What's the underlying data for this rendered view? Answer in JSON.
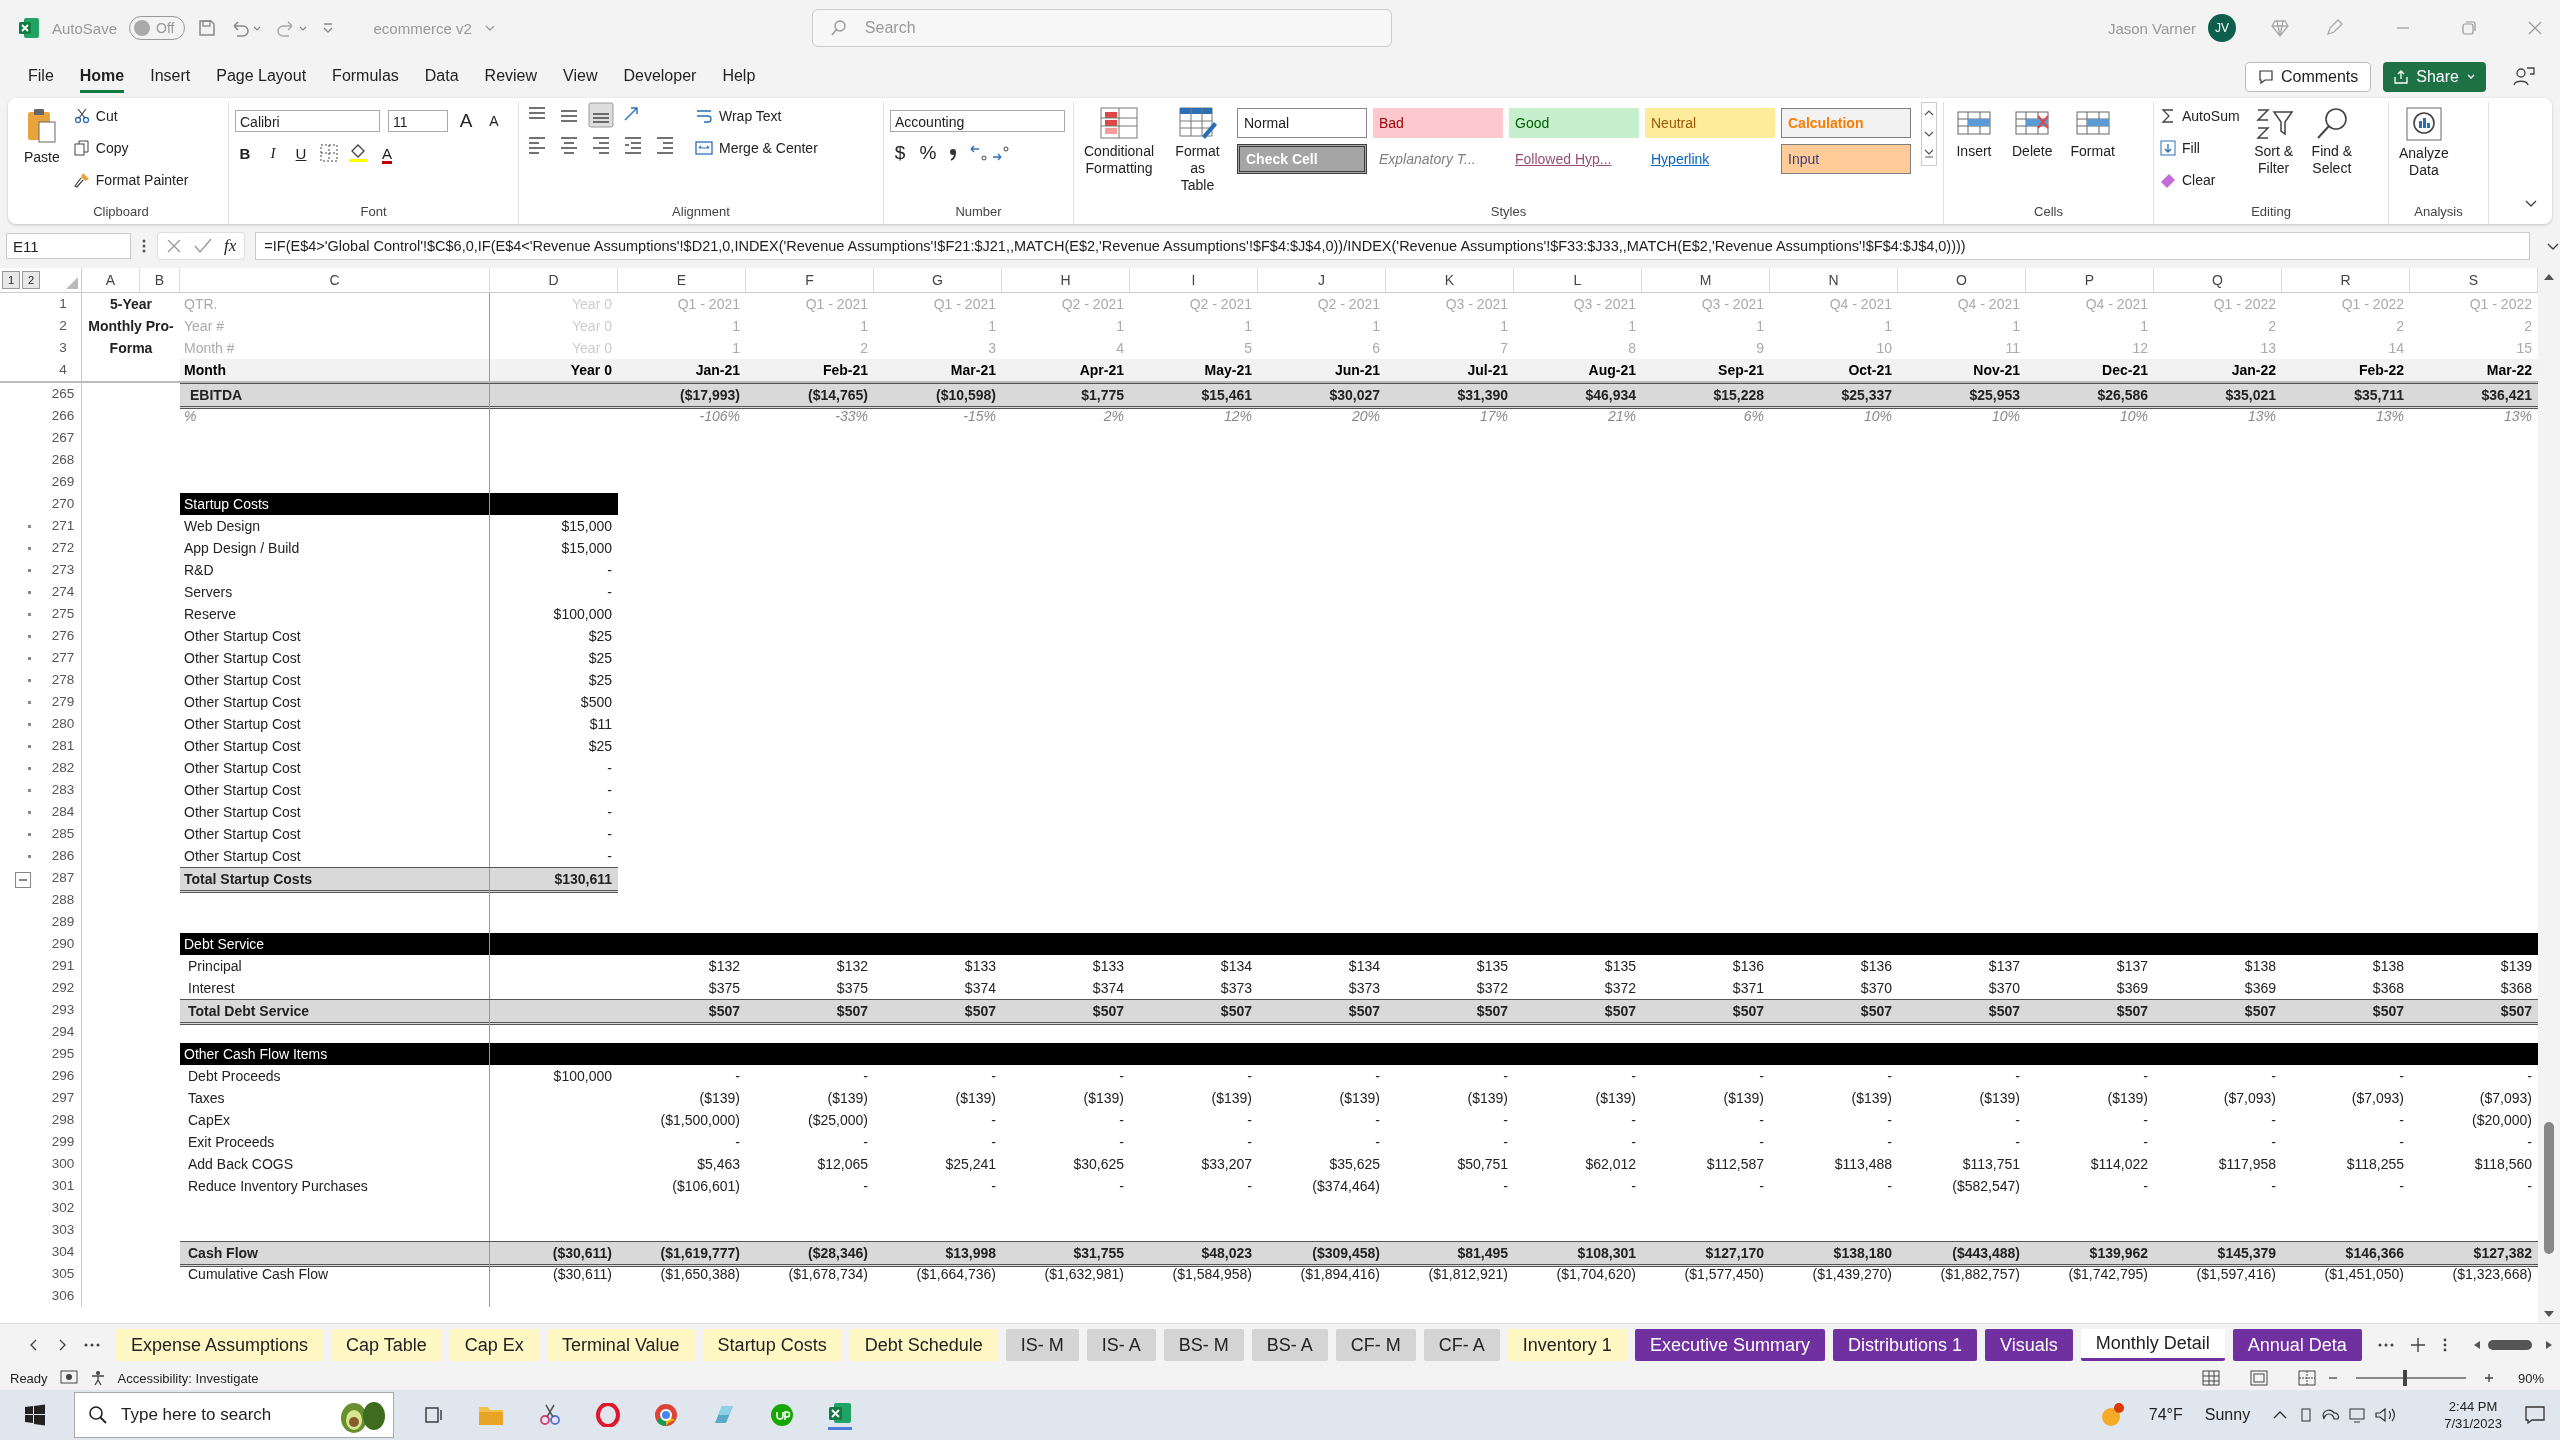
{
  "title_bar": {
    "autosave_label": "AutoSave",
    "autosave": {
      "on": false,
      "label": "Off"
    },
    "file_name": "ecommerce v2",
    "search_placeholder": "Search",
    "user_name": "Jason Varner",
    "avatar_initials": "JV"
  },
  "menu": [
    {
      "label": "File",
      "selected": false
    },
    {
      "label": "Home",
      "selected": true
    },
    {
      "label": "Insert",
      "selected": false
    },
    {
      "label": "Page Layout",
      "selected": false
    },
    {
      "label": "Formulas",
      "selected": false
    },
    {
      "label": "Data",
      "selected": false
    },
    {
      "label": "Review",
      "selected": false
    },
    {
      "label": "View",
      "selected": false
    },
    {
      "label": "Developer",
      "selected": false
    },
    {
      "label": "Help",
      "selected": false
    }
  ],
  "comments_button": "Comments",
  "share_button": "Share",
  "ribbon": {
    "clipboard": {
      "title": "Clipboard",
      "paste": "Paste",
      "cut": "Cut",
      "copy": "Copy",
      "format_painter": "Format Painter"
    },
    "font": {
      "title": "Font",
      "family": "Calibri",
      "size": "11",
      "grow": "A",
      "shrink": "A",
      "bold": "B",
      "italic": "I",
      "underline": "U",
      "font_color_button": "A"
    },
    "alignment": {
      "title": "Alignment",
      "wrap_text": "Wrap Text",
      "merge_center": "Merge & Center"
    },
    "number": {
      "title": "Number",
      "format": "Accounting",
      "currency": "$",
      "percent": "%"
    },
    "styles": {
      "title": "Styles",
      "conditional_formatting": [
        "Conditional",
        "Formatting"
      ],
      "format_as_table": [
        "Format as",
        "Table"
      ],
      "cell_styles": [
        {
          "label": "Normal",
          "kind": "normal"
        },
        {
          "label": "Bad",
          "kind": "bad"
        },
        {
          "label": "Good",
          "kind": "good"
        },
        {
          "label": "Neutral",
          "kind": "neutral"
        },
        {
          "label": "Calculation",
          "kind": "calculation"
        },
        {
          "label": "Check Cell",
          "kind": "check"
        },
        {
          "label": "Explanatory T...",
          "kind": "explanatory"
        },
        {
          "label": "Followed Hyp...",
          "kind": "followed"
        },
        {
          "label": "Hyperlink",
          "kind": "hyperlink"
        },
        {
          "label": "Input",
          "kind": "input"
        }
      ]
    },
    "cells": {
      "title": "Cells",
      "buttons": [
        "Insert",
        "Delete",
        "Format"
      ]
    },
    "editing": {
      "title": "Editing",
      "autosum": "AutoSum",
      "fill": "Fill",
      "clear": "Clear",
      "sort_filter": [
        "Sort &",
        "Filter"
      ],
      "find_select": [
        "Find &",
        "Select"
      ]
    },
    "analysis": {
      "title": "Analysis",
      "analyze_data": [
        "Analyze",
        "Data"
      ]
    }
  },
  "formula_bar": {
    "name_box": "E11",
    "fx": "fx",
    "formula": "=IF(E$4>'Global Control'!$C$6,0,IF(E$4<'Revenue Assumptions'!$D21,0,INDEX('Revenue Assumptions'!$F21:$J21,,MATCH(E$2,'Revenue Assumptions'!$F$4:$J$4,0))/INDEX('Revenue Assumptions'!$F33:$J33,,MATCH(E$2,'Revenue Assumptions'!$F$4:$J$4,0))))"
  },
  "grid": {
    "outline_levels": [
      "1",
      "2"
    ],
    "columns": [
      "A",
      "B",
      "C",
      "D",
      "E",
      "F",
      "G",
      "H",
      "I",
      "J",
      "K",
      "L",
      "M",
      "N",
      "O",
      "P",
      "Q",
      "R",
      "S"
    ],
    "header": {
      "title": "5-Year Monthly Pro-Forma",
      "row_numbers": [
        "1",
        "2",
        "3",
        "4"
      ],
      "labels": [
        "QTR.",
        "Year #",
        "Month #",
        "Month"
      ],
      "year0": [
        "Year 0",
        "Year 0",
        "Year 0",
        "Year 0"
      ],
      "quarters": [
        "Q1 - 2021",
        "Q1 - 2021",
        "Q1 - 2021",
        "Q2 - 2021",
        "Q2 - 2021",
        "Q2 - 2021",
        "Q3 - 2021",
        "Q3 - 2021",
        "Q3 - 2021",
        "Q4 - 2021",
        "Q4 - 2021",
        "Q4 - 2021",
        "Q1 - 2022",
        "Q1 - 2022",
        "Q1 - 2022"
      ],
      "years": [
        "1",
        "1",
        "1",
        "1",
        "1",
        "1",
        "1",
        "1",
        "1",
        "1",
        "1",
        "1",
        "2",
        "2",
        "2"
      ],
      "month_numbers": [
        "1",
        "2",
        "3",
        "4",
        "5",
        "6",
        "7",
        "8",
        "9",
        "10",
        "11",
        "12",
        "13",
        "14",
        "15"
      ],
      "months": [
        "Jan-21",
        "Feb-21",
        "Mar-21",
        "Apr-21",
        "May-21",
        "Jun-21",
        "Jul-21",
        "Aug-21",
        "Sep-21",
        "Oct-21",
        "Nov-21",
        "Dec-21",
        "Jan-22",
        "Feb-22",
        "Mar-22"
      ]
    },
    "rows": [
      {
        "row": "265",
        "kind": "ebitda",
        "label": "EBITDA",
        "values": [
          "($17,993)",
          "($14,765)",
          "($10,598)",
          "$1,775",
          "$15,461",
          "$30,027",
          "$31,390",
          "$46,934",
          "$15,228",
          "$25,337",
          "$25,953",
          "$26,586",
          "$35,021",
          "$35,711",
          "$36,421"
        ]
      },
      {
        "row": "266",
        "kind": "pct",
        "label": "%",
        "values": [
          "-106%",
          "-33%",
          "-15%",
          "2%",
          "12%",
          "20%",
          "17%",
          "21%",
          "6%",
          "10%",
          "10%",
          "10%",
          "13%",
          "13%",
          "13%"
        ]
      },
      {
        "row": "267",
        "kind": "blank"
      },
      {
        "row": "268",
        "kind": "blank"
      },
      {
        "row": "269",
        "kind": "blank"
      },
      {
        "row": "270",
        "kind": "section_narrow",
        "label": "Startup Costs"
      },
      {
        "row": "271",
        "kind": "item",
        "label": "Web Design",
        "d": "$15,000",
        "grouped": true
      },
      {
        "row": "272",
        "kind": "item",
        "label": "App Design / Build",
        "d": "$15,000",
        "grouped": true
      },
      {
        "row": "273",
        "kind": "item",
        "label": "R&D",
        "d": "-",
        "grouped": true
      },
      {
        "row": "274",
        "kind": "item",
        "label": "Servers",
        "d": "-",
        "grouped": true
      },
      {
        "row": "275",
        "kind": "item",
        "label": "Reserve",
        "d": "$100,000",
        "grouped": true
      },
      {
        "row": "276",
        "kind": "item",
        "label": "Other Startup Cost",
        "d": "$25",
        "grouped": true
      },
      {
        "row": "277",
        "kind": "item",
        "label": "Other Startup Cost",
        "d": "$25",
        "grouped": true
      },
      {
        "row": "278",
        "kind": "item",
        "label": "Other Startup Cost",
        "d": "$25",
        "grouped": true
      },
      {
        "row": "279",
        "kind": "item",
        "label": "Other Startup Cost",
        "d": "$500",
        "grouped": true
      },
      {
        "row": "280",
        "kind": "item",
        "label": "Other Startup Cost",
        "d": "$11",
        "grouped": true
      },
      {
        "row": "281",
        "kind": "item",
        "label": "Other Startup Cost",
        "d": "$25",
        "grouped": true
      },
      {
        "row": "282",
        "kind": "item",
        "label": "Other Startup Cost",
        "d": "-",
        "grouped": true
      },
      {
        "row": "283",
        "kind": "item",
        "label": "Other Startup Cost",
        "d": "-",
        "grouped": true
      },
      {
        "row": "284",
        "kind": "item",
        "label": "Other Startup Cost",
        "d": "-",
        "grouped": true
      },
      {
        "row": "285",
        "kind": "item",
        "label": "Other Startup Cost",
        "d": "-",
        "grouped": true
      },
      {
        "row": "286",
        "kind": "item",
        "label": "Other Startup Cost",
        "d": "-",
        "grouped": true
      },
      {
        "row": "287",
        "kind": "total_narrow",
        "label": "Total Startup Costs",
        "d": "$130,611",
        "expanded": true
      },
      {
        "row": "288",
        "kind": "blank"
      },
      {
        "row": "289",
        "kind": "blank"
      },
      {
        "row": "290",
        "kind": "section",
        "label": "Debt Service"
      },
      {
        "row": "291",
        "kind": "sub",
        "label": "Principal",
        "values": [
          "$132",
          "$132",
          "$133",
          "$133",
          "$134",
          "$134",
          "$135",
          "$135",
          "$136",
          "$136",
          "$137",
          "$137",
          "$138",
          "$138",
          "$139"
        ]
      },
      {
        "row": "292",
        "kind": "sub",
        "label": "Interest",
        "values": [
          "$375",
          "$375",
          "$374",
          "$374",
          "$373",
          "$373",
          "$372",
          "$372",
          "$371",
          "$370",
          "$370",
          "$369",
          "$369",
          "$368",
          "$368"
        ]
      },
      {
        "row": "293",
        "kind": "total",
        "label": "Total Debt Service",
        "values": [
          "$507",
          "$507",
          "$507",
          "$507",
          "$507",
          "$507",
          "$507",
          "$507",
          "$507",
          "$507",
          "$507",
          "$507",
          "$507",
          "$507",
          "$507"
        ]
      },
      {
        "row": "294",
        "kind": "blank"
      },
      {
        "row": "295",
        "kind": "section",
        "label": "Other Cash Flow Items"
      },
      {
        "row": "296",
        "kind": "sub",
        "label": "Debt Proceeds",
        "d": "$100,000",
        "values": [
          "-",
          "-",
          "-",
          "-",
          "-",
          "-",
          "-",
          "-",
          "-",
          "-",
          "-",
          "-",
          "-",
          "-",
          "-"
        ]
      },
      {
        "row": "297",
        "kind": "sub",
        "label": "Taxes",
        "values": [
          "($139)",
          "($139)",
          "($139)",
          "($139)",
          "($139)",
          "($139)",
          "($139)",
          "($139)",
          "($139)",
          "($139)",
          "($139)",
          "($139)",
          "($7,093)",
          "($7,093)",
          "($7,093)"
        ]
      },
      {
        "row": "298",
        "kind": "sub",
        "label": "CapEx",
        "values": [
          "($1,500,000)",
          "($25,000)",
          "-",
          "-",
          "-",
          "-",
          "-",
          "-",
          "-",
          "-",
          "-",
          "-",
          "-",
          "-",
          "($20,000)"
        ]
      },
      {
        "row": "299",
        "kind": "sub",
        "label": "Exit Proceeds",
        "values": [
          "-",
          "-",
          "-",
          "-",
          "-",
          "-",
          "-",
          "-",
          "-",
          "-",
          "-",
          "-",
          "-",
          "-",
          "-"
        ]
      },
      {
        "row": "300",
        "kind": "sub",
        "label": "Add Back COGS",
        "values": [
          "$5,463",
          "$12,065",
          "$25,241",
          "$30,625",
          "$33,207",
          "$35,625",
          "$50,751",
          "$62,012",
          "$112,587",
          "$113,488",
          "$113,751",
          "$114,022",
          "$117,958",
          "$118,255",
          "$118,560"
        ]
      },
      {
        "row": "301",
        "kind": "sub",
        "label": "Reduce Inventory Purchases",
        "values": [
          "($106,601)",
          "-",
          "-",
          "-",
          "-",
          "($374,464)",
          "-",
          "-",
          "-",
          "-",
          "($582,547)",
          "-",
          "-",
          "-",
          "-"
        ]
      },
      {
        "row": "302",
        "kind": "blank"
      },
      {
        "row": "303",
        "kind": "blank"
      },
      {
        "row": "304",
        "kind": "total",
        "label": "Cash Flow",
        "d": "($30,611)",
        "values": [
          "($1,619,777)",
          "($28,346)",
          "$13,998",
          "$31,755",
          "$48,023",
          "($309,458)",
          "$81,495",
          "$108,301",
          "$127,170",
          "$138,180",
          "($443,488)",
          "$139,962",
          "$145,379",
          "$146,366",
          "$127,382"
        ]
      },
      {
        "row": "305",
        "kind": "plain",
        "label": "Cumulative Cash Flow",
        "d": "($30,611)",
        "values": [
          "($1,650,388)",
          "($1,678,734)",
          "($1,664,736)",
          "($1,632,981)",
          "($1,584,958)",
          "($1,894,416)",
          "($1,812,921)",
          "($1,704,620)",
          "($1,577,450)",
          "($1,439,270)",
          "($1,882,757)",
          "($1,742,795)",
          "($1,597,416)",
          "($1,451,050)",
          "($1,323,668)"
        ]
      },
      {
        "row": "306",
        "kind": "blank"
      }
    ]
  },
  "sheet_tabs": [
    {
      "label": "Expense Assumptions",
      "color": "#fff8c4",
      "selected": false
    },
    {
      "label": "Cap Table",
      "color": "#fff8c4",
      "selected": false
    },
    {
      "label": "Cap Ex",
      "color": "#fff8c4",
      "selected": false
    },
    {
      "label": "Terminal Value",
      "color": "#fff8c4",
      "selected": false
    },
    {
      "label": "Startup Costs",
      "color": "#fff8c4",
      "selected": false
    },
    {
      "label": "Debt Schedule",
      "color": "#fff8c4",
      "selected": false
    },
    {
      "label": "IS- M",
      "color": "#d4d4d4",
      "selected": false
    },
    {
      "label": "IS- A",
      "color": "#d4d4d4",
      "selected": false
    },
    {
      "label": "BS- M",
      "color": "#d4d4d4",
      "selected": false
    },
    {
      "label": "BS- A",
      "color": "#d4d4d4",
      "selected": false
    },
    {
      "label": "CF- M",
      "color": "#d4d4d4",
      "selected": false
    },
    {
      "label": "CF- A",
      "color": "#d4d4d4",
      "selected": false
    },
    {
      "label": "Inventory 1",
      "color": "#fff8c4",
      "selected": false
    },
    {
      "label": "Executive Summary",
      "color": "#7030a0",
      "selected": false
    },
    {
      "label": "Distributions 1",
      "color": "#7030a0",
      "selected": false
    },
    {
      "label": "Visuals",
      "color": "#7030a0",
      "selected": false
    },
    {
      "label": "Monthly Detail",
      "color": "#7030a0",
      "selected": true
    },
    {
      "label": "Annual Deta",
      "color": "#7030a0",
      "selected": false
    }
  ],
  "status_bar": {
    "ready": "Ready",
    "accessibility": "Accessibility: Investigate",
    "zoom": "90%",
    "zoom_slider": {
      "level": 0.45
    }
  },
  "taskbar": {
    "search_placeholder": "Type here to search",
    "temperature": "74°F",
    "weather": "Sunny",
    "time": "2:44 PM",
    "date": "7/31/2023"
  }
}
